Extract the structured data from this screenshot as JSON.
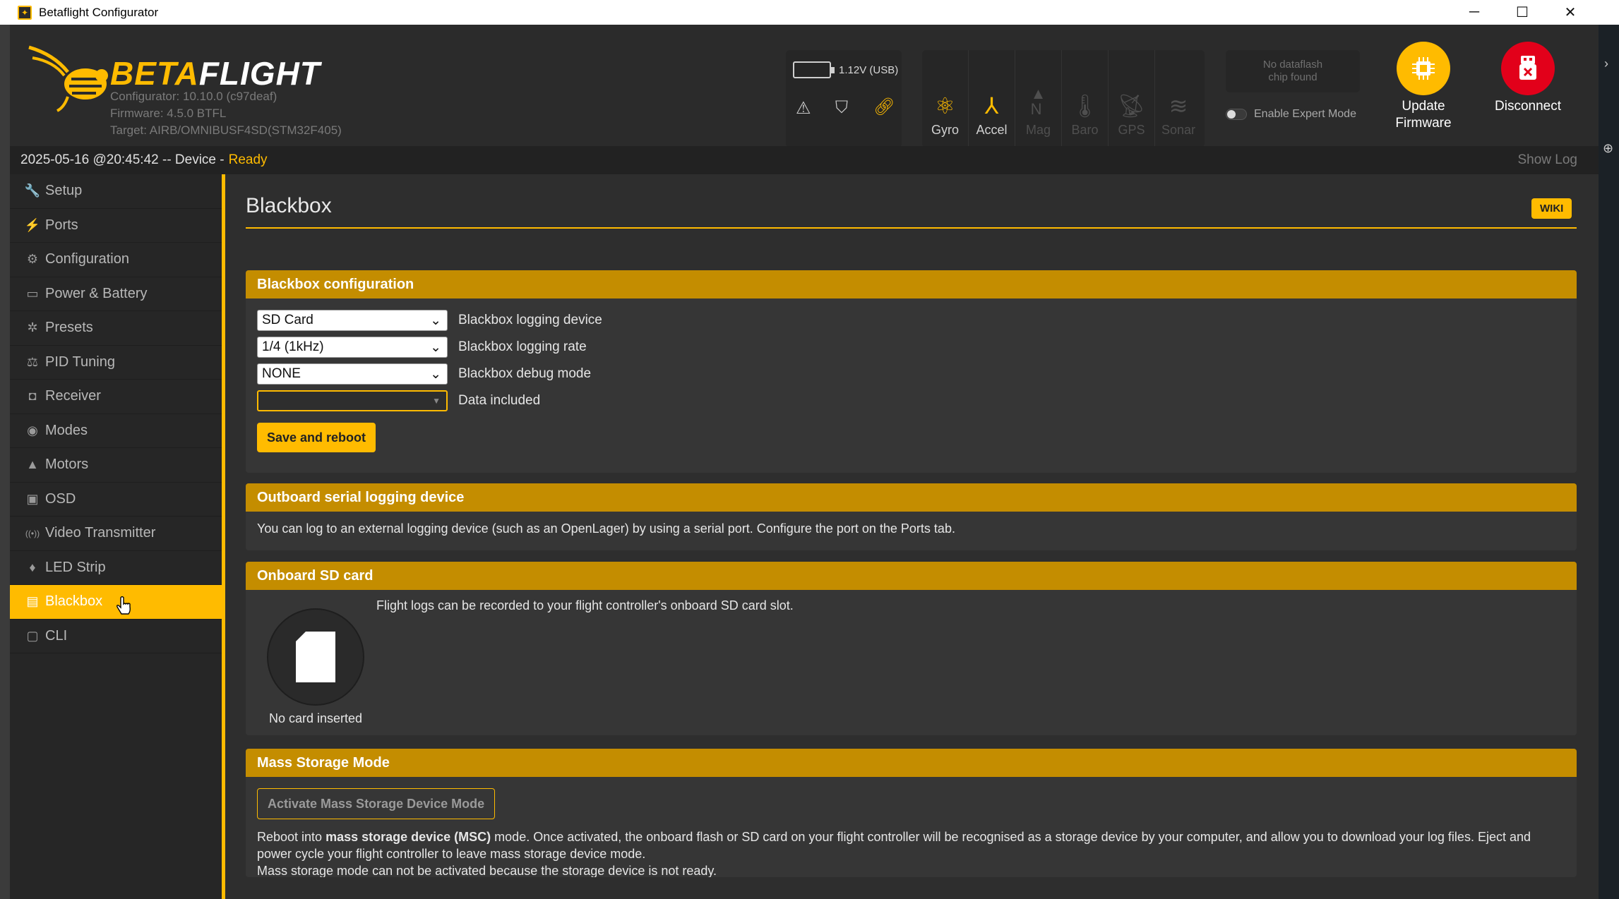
{
  "window": {
    "title": "Betaflight Configurator",
    "controls": {
      "minimize": "─",
      "maximize": "☐",
      "close": "✕"
    }
  },
  "header": {
    "logo_beta": "BETA",
    "logo_flight": "FLIGHT",
    "configurator": "Configurator: 10.10.0 (c97deaf)",
    "firmware": "Firmware: 4.5.0 BTFL",
    "target": "Target: AIRB/OMNIBUSF4SD(STM32F405)",
    "battery": "1.12V (USB)",
    "sensors": [
      {
        "label": "Gyro",
        "icon": "gyro-icon",
        "active": true
      },
      {
        "label": "Accel",
        "icon": "accel-icon",
        "active": true
      },
      {
        "label": "Mag",
        "icon": "mag-icon",
        "active": false
      },
      {
        "label": "Baro",
        "icon": "baro-icon",
        "active": false
      },
      {
        "label": "GPS",
        "icon": "gps-icon",
        "active": false
      },
      {
        "label": "Sonar",
        "icon": "sonar-icon",
        "active": false
      }
    ],
    "dataflash_line1": "No dataflash",
    "dataflash_line2": "chip found",
    "expert_mode": "Enable Expert Mode",
    "update_line1": "Update",
    "update_line2": "Firmware",
    "disconnect": "Disconnect"
  },
  "status": {
    "time": "2025-05-16 @20:45:42 -- Device -",
    "ready": "Ready",
    "show_log": "Show Log"
  },
  "sidebar": {
    "items": [
      {
        "label": "Setup",
        "icon": "wrench-icon",
        "glyph": "🔧"
      },
      {
        "label": "Ports",
        "icon": "plug-icon",
        "glyph": "⚡"
      },
      {
        "label": "Configuration",
        "icon": "gear-icon",
        "glyph": "⚙"
      },
      {
        "label": "Power & Battery",
        "icon": "battery-icon",
        "glyph": "▭"
      },
      {
        "label": "Presets",
        "icon": "presets-icon",
        "glyph": "✲"
      },
      {
        "label": "PID Tuning",
        "icon": "pid-icon",
        "glyph": "⚖"
      },
      {
        "label": "Receiver",
        "icon": "receiver-icon",
        "glyph": "◘"
      },
      {
        "label": "Modes",
        "icon": "modes-icon",
        "glyph": "◉"
      },
      {
        "label": "Motors",
        "icon": "motor-icon",
        "glyph": "▲"
      },
      {
        "label": "OSD",
        "icon": "osd-icon",
        "glyph": "▣"
      },
      {
        "label": "Video Transmitter",
        "icon": "vtx-icon",
        "glyph": "((•))"
      },
      {
        "label": "LED Strip",
        "icon": "led-icon",
        "glyph": "♦"
      },
      {
        "label": "Blackbox",
        "icon": "blackbox-icon",
        "glyph": "▤"
      },
      {
        "label": "CLI",
        "icon": "cli-icon",
        "glyph": "▢"
      }
    ],
    "active": "Blackbox"
  },
  "page": {
    "title": "Blackbox",
    "wiki": "WIKI"
  },
  "config_panel": {
    "title": "Blackbox configuration",
    "device_value": "SD Card",
    "device_label": "Blackbox logging device",
    "rate_value": "1/4 (1kHz)",
    "rate_label": "Blackbox logging rate",
    "debug_value": "NONE",
    "debug_label": "Blackbox debug mode",
    "data_value": "",
    "data_label": "Data included",
    "save_button": "Save and reboot"
  },
  "outboard_panel": {
    "title": "Outboard serial logging device",
    "text": "You can log to an external logging device (such as an OpenLager) by using a serial port. Configure the port on the Ports tab."
  },
  "sd_panel": {
    "title": "Onboard SD card",
    "text": "Flight logs can be recorded to your flight controller's onboard SD card slot.",
    "status": "No card inserted"
  },
  "msc_panel": {
    "title": "Mass Storage Mode",
    "button": "Activate Mass Storage Device Mode",
    "text_pre": "Reboot into ",
    "text_bold": "mass storage device (MSC)",
    "text_post": " mode. Once activated, the onboard flash or SD card on your flight controller will be recognised as a storage device by your computer, and allow you to download your log files. Eject and power cycle your flight controller to leave mass storage device mode.",
    "text_line2": "Mass storage mode can not be activated because the storage device is not ready."
  },
  "colors": {
    "accent": "#ffbb00",
    "panel_head": "#c48d00",
    "disconnect": "#e2001a"
  }
}
